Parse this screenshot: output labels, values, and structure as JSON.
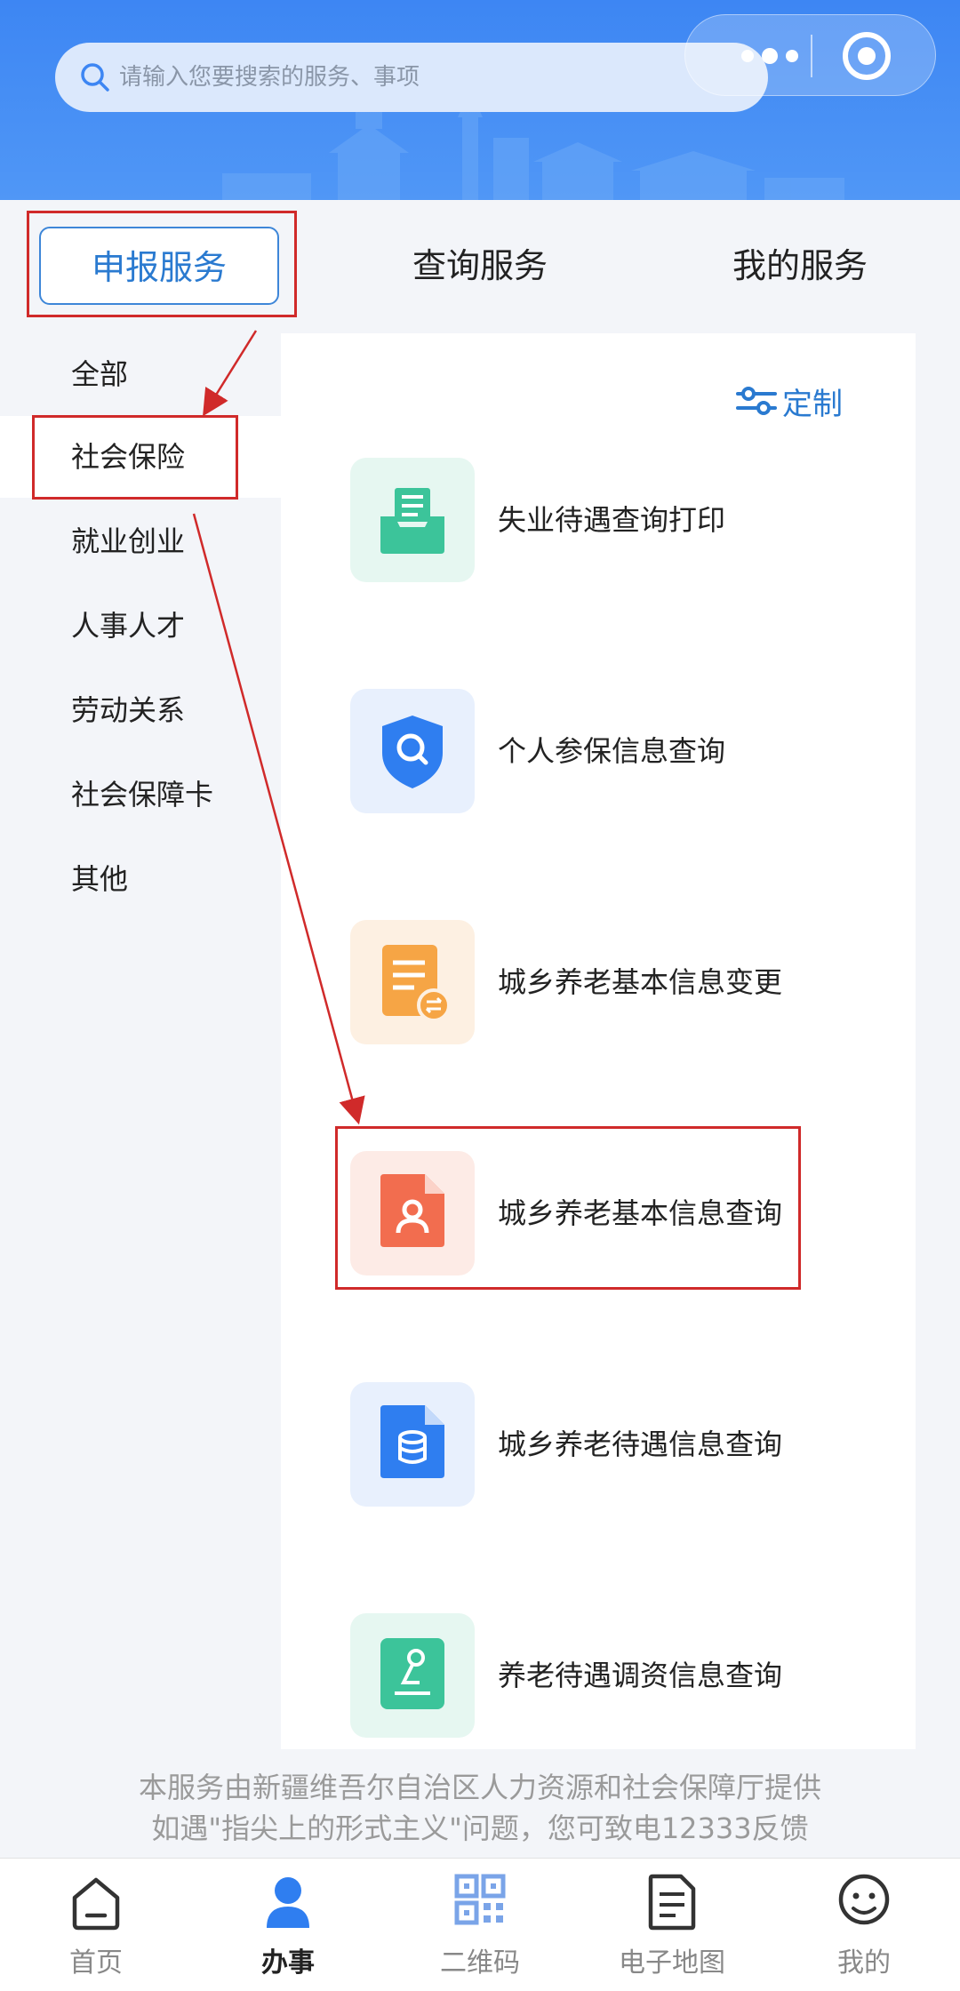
{
  "search": {
    "placeholder": "请输入您要搜索的服务、事项"
  },
  "tabs": [
    {
      "label": "申报服务",
      "active": true
    },
    {
      "label": "查询服务",
      "active": false
    },
    {
      "label": "我的服务",
      "active": false
    }
  ],
  "categories": [
    {
      "label": "全部"
    },
    {
      "label": "社会保险",
      "active": true
    },
    {
      "label": "就业创业"
    },
    {
      "label": "人事人才"
    },
    {
      "label": "劳动关系"
    },
    {
      "label": "社会保障卡"
    },
    {
      "label": "其他"
    }
  ],
  "panel": {
    "customize_label": "定制",
    "services": [
      {
        "label": "失业待遇查询打印",
        "icon": "inbox-print-icon",
        "icon_bg": "#e6f7f1",
        "icon_color": "#3cc49a"
      },
      {
        "label": "个人参保信息查询",
        "icon": "shield-search-icon",
        "icon_bg": "#e8f0fd",
        "icon_color": "#2f7ef0"
      },
      {
        "label": "城乡养老基本信息变更",
        "icon": "document-swap-icon",
        "icon_bg": "#fdf0e2",
        "icon_color": "#f6a545"
      },
      {
        "label": "城乡养老基本信息查询",
        "icon": "document-person-icon",
        "icon_bg": "#fdebe6",
        "icon_color": "#f26d4f"
      },
      {
        "label": "城乡养老待遇信息查询",
        "icon": "document-coins-icon",
        "icon_bg": "#e8f0fd",
        "icon_color": "#2f7ef0"
      },
      {
        "label": "养老待遇调资信息查询",
        "icon": "adjust-icon",
        "icon_bg": "#e6f7f1",
        "icon_color": "#3cc49a"
      }
    ]
  },
  "notice": {
    "line1": "本服务由新疆维吾尔自治区人力资源和社会保障厅提供",
    "line2": "如遇\"指尖上的形式主义\"问题，您可致电12333反馈"
  },
  "bottom_nav": [
    {
      "label": "首页",
      "icon": "home-icon"
    },
    {
      "label": "办事",
      "icon": "person-icon",
      "active": true
    },
    {
      "label": "二维码",
      "icon": "qr-code-icon"
    },
    {
      "label": "电子地图",
      "icon": "map-document-icon"
    },
    {
      "label": "我的",
      "icon": "smile-face-icon"
    }
  ],
  "colors": {
    "header_blue": "#3d86f3",
    "accent": "#2a7ad0",
    "annotation_red": "#d02a2a"
  }
}
